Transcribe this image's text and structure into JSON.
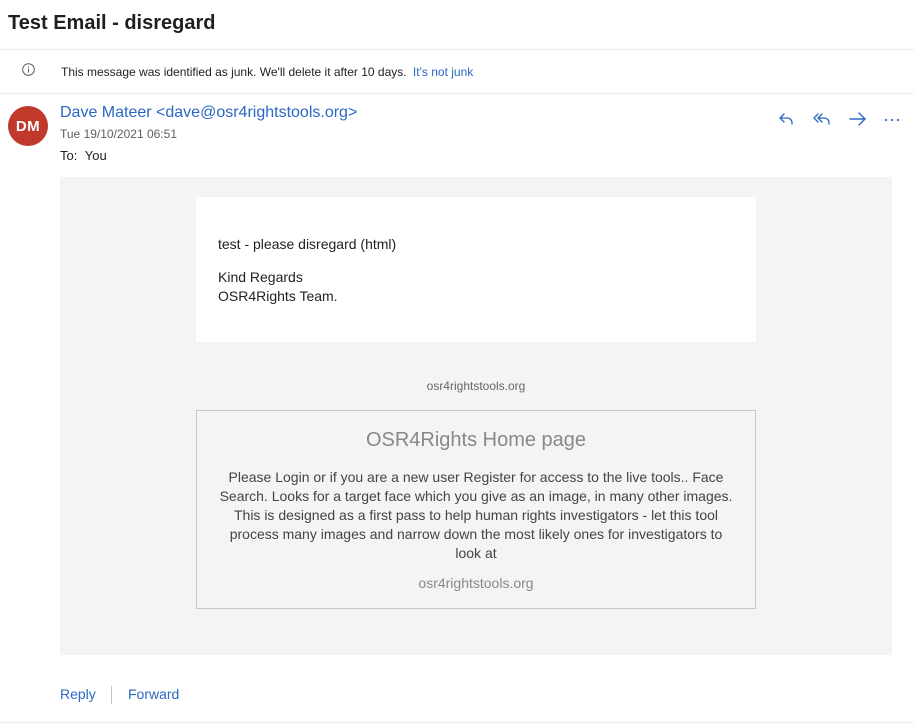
{
  "email": {
    "subject": "Test Email - disregard",
    "junk_banner": {
      "icon": "info-icon",
      "text": "This message was identified as junk. We'll delete it after 10 days.",
      "link": "It's not junk"
    },
    "sender": {
      "initials": "DM",
      "display": "Dave Mateer <dave@osr4rightstools.org>",
      "avatar_color": "#c0392b"
    },
    "date": "Tue 19/10/2021 06:51",
    "to": {
      "label": "To:",
      "value": "You"
    },
    "actions": [
      {
        "name": "reply",
        "icon": "reply-icon"
      },
      {
        "name": "reply-all",
        "icon": "reply-all-icon"
      },
      {
        "name": "forward",
        "icon": "forward-icon"
      },
      {
        "name": "more",
        "icon": "more-actions-icon"
      }
    ],
    "body": {
      "line1": "test - please disregard (html)",
      "line2": "Kind Regards",
      "line3": "OSR4Rights Team.",
      "domain": "osr4rightstools.org"
    },
    "link_preview": {
      "title": "OSR4Rights Home page",
      "description": "Please Login or if you are a new user Register for access to the live tools.. Face Search. Looks for a target face which you give as an image, in many other images. This is designed as a first pass to help human rights investigators - let this tool process many images and narrow down the most likely ones for investigators to look at",
      "domain": "osr4rightstools.org"
    },
    "footer": {
      "reply_label": "Reply",
      "forward_label": "Forward"
    },
    "colors": {
      "accent": "#2b67c4",
      "body_background": "#f4f4f4"
    }
  }
}
